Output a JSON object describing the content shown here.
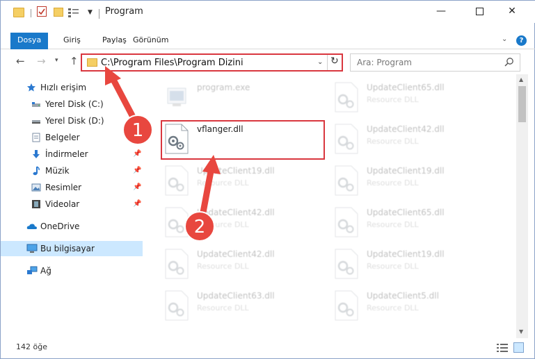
{
  "window": {
    "title": "Program",
    "minimize": "—",
    "close": "✕"
  },
  "ribbon": {
    "tabs": [
      "Dosya",
      "Giriş",
      "Paylaş",
      "Görünüm"
    ],
    "help": "?"
  },
  "nav": {
    "address": "C:\\Program Files\\Program Dizini",
    "search_placeholder": "Ara: Program"
  },
  "sidebar": {
    "items": [
      {
        "label": "Hızlı erişim",
        "icon": "star-icon"
      },
      {
        "label": "Yerel Disk (C:)",
        "icon": "drive-icon"
      },
      {
        "label": "Yerel Disk (D:)",
        "icon": "drive-icon"
      },
      {
        "label": "Belgeler",
        "icon": "documents-icon"
      },
      {
        "label": "İndirmeler",
        "icon": "download-icon"
      },
      {
        "label": "Müzik",
        "icon": "music-icon"
      },
      {
        "label": "Resimler",
        "icon": "pictures-icon"
      },
      {
        "label": "Videolar",
        "icon": "video-icon"
      },
      {
        "label": "OneDrive",
        "icon": "cloud-icon"
      },
      {
        "label": "Bu bilgisayar",
        "icon": "computer-icon"
      },
      {
        "label": "Ağ",
        "icon": "network-icon"
      }
    ]
  },
  "files": {
    "col1": [
      {
        "name": "program.exe",
        "type": ""
      },
      {
        "name": "vflanger.dll",
        "type": ""
      },
      {
        "name": "UpdateClient19.dll",
        "type": "Resource DLL"
      },
      {
        "name": "UpdateClient42.dll",
        "type": "Resource DLL"
      },
      {
        "name": "UpdateClient42.dll",
        "type": "Resource DLL"
      },
      {
        "name": "UpdateClient63.dll",
        "type": "Resource DLL"
      }
    ],
    "col2": [
      {
        "name": "UpdateClient65.dll",
        "type": "Resource DLL"
      },
      {
        "name": "UpdateClient42.dll",
        "type": "Resource DLL"
      },
      {
        "name": "UpdateClient19.dll",
        "type": "Resource DLL"
      },
      {
        "name": "UpdateClient65.dll",
        "type": "Resource DLL"
      },
      {
        "name": "UpdateClient19.dll",
        "type": "Resource DLL"
      },
      {
        "name": "UpdateClient5.dll",
        "type": "Resource DLL"
      }
    ]
  },
  "annotations": {
    "step1": "1",
    "step2": "2",
    "color": "#e8473f"
  },
  "status": {
    "count": "142 öğe"
  }
}
